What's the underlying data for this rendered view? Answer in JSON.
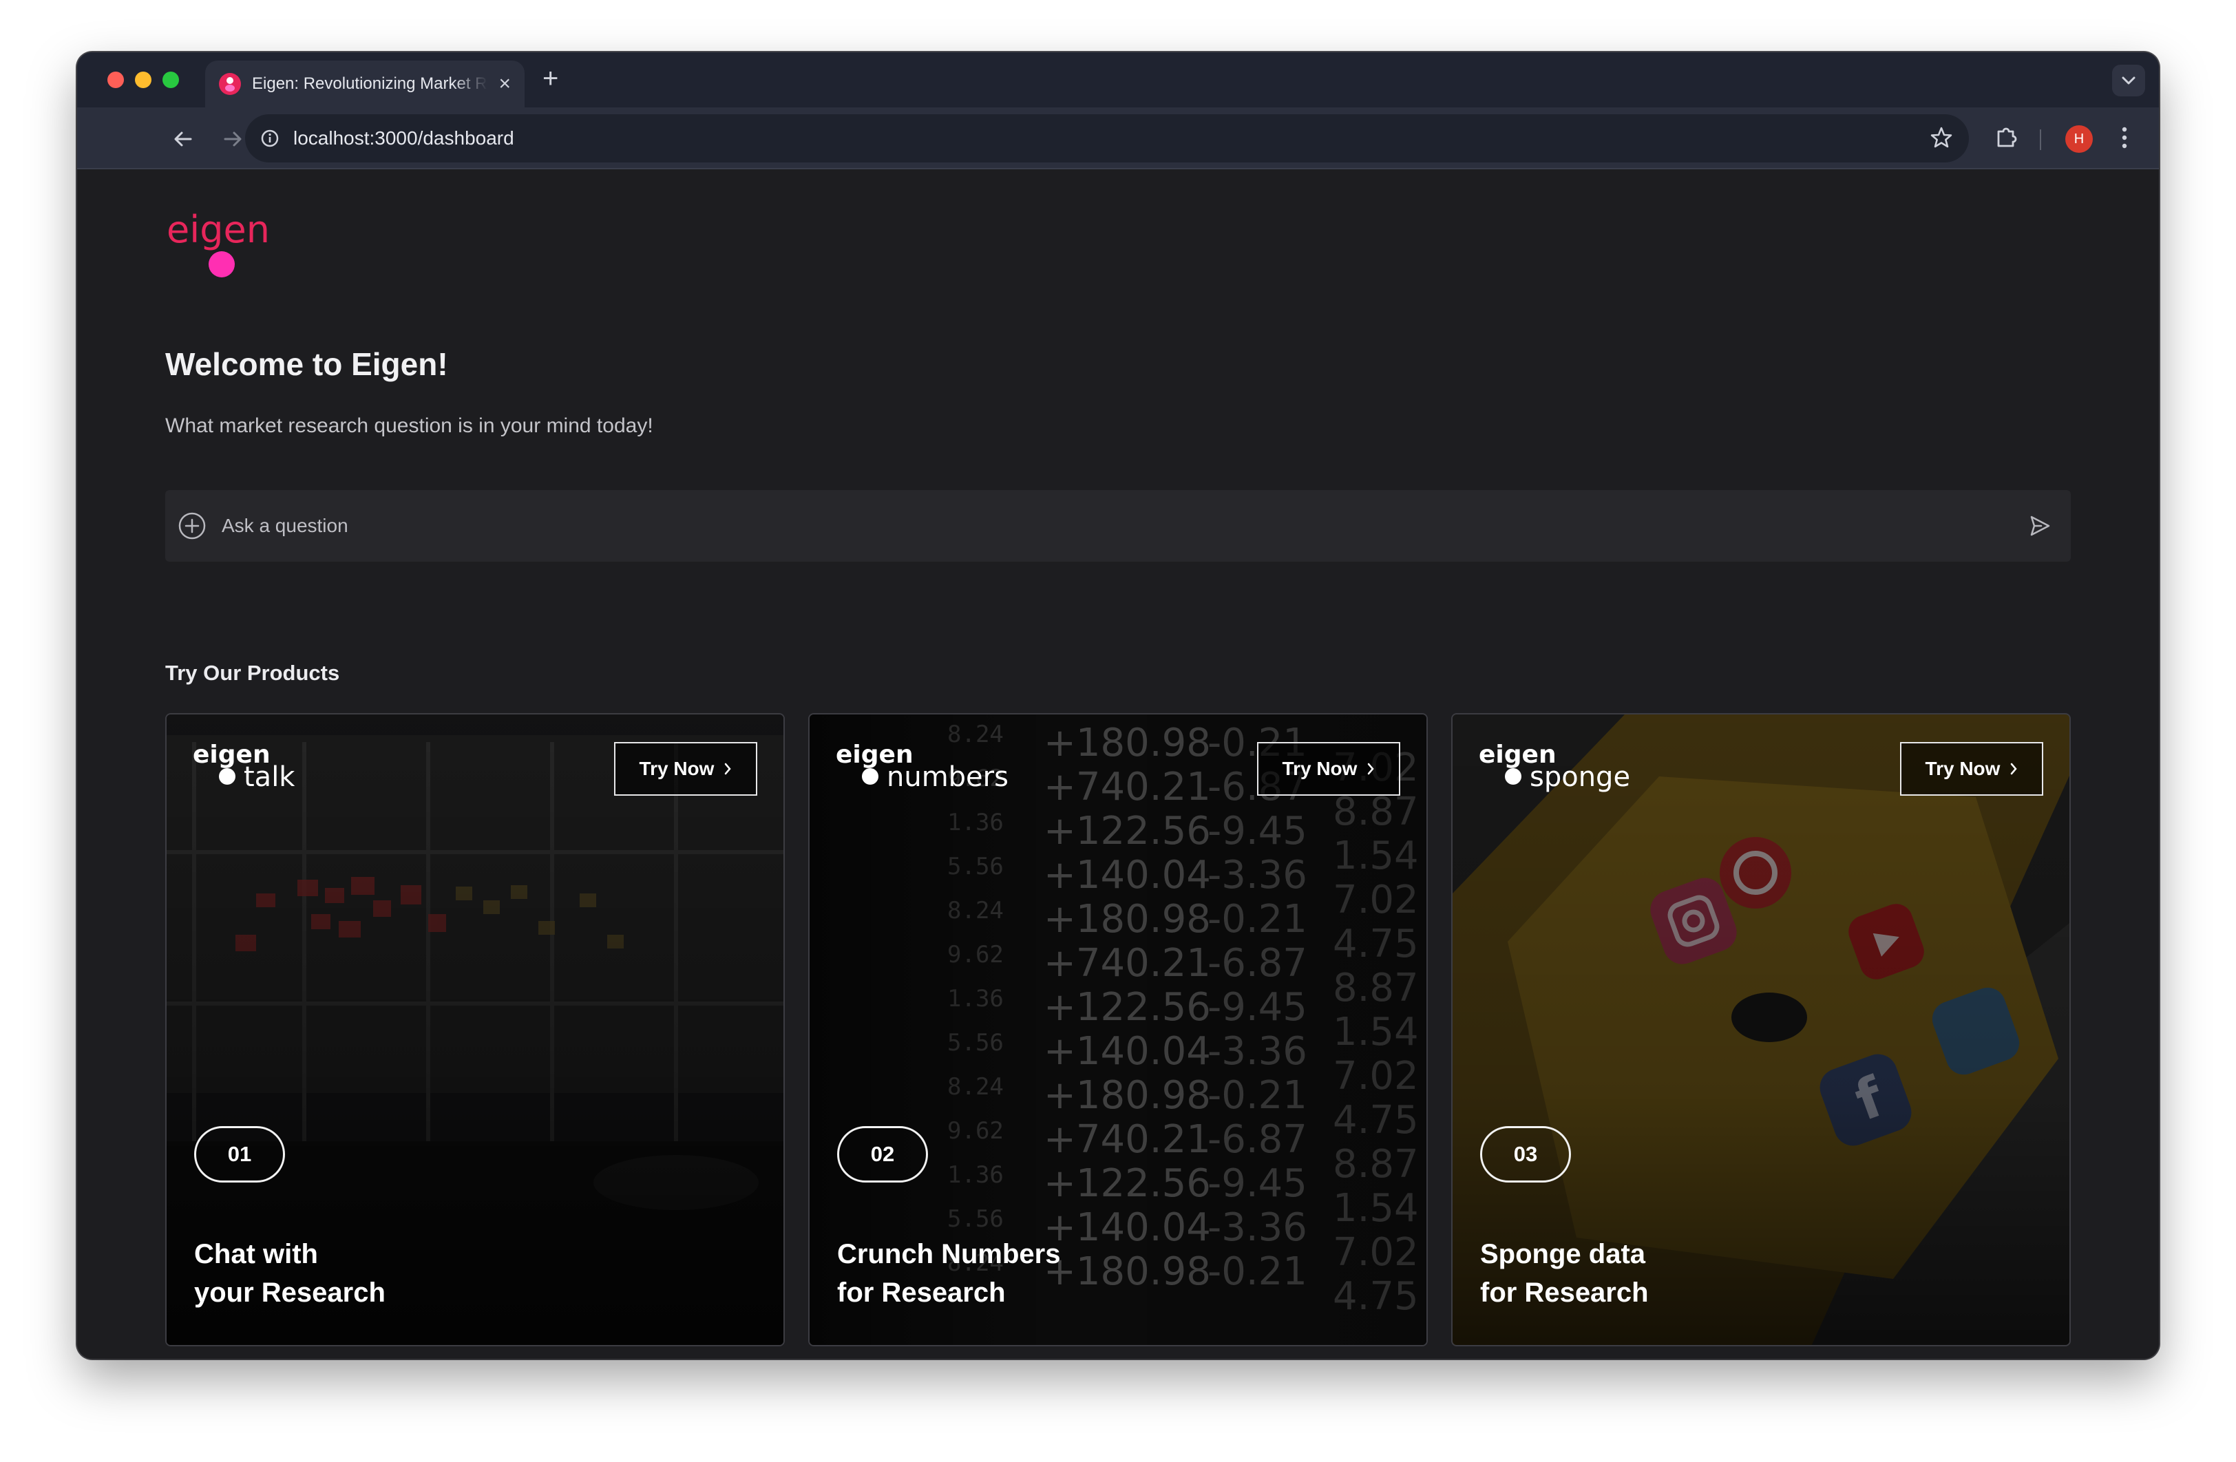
{
  "browser": {
    "tab_title": "Eigen: Revolutionizing Market Research",
    "url": "localhost:3000/dashboard",
    "avatar_initial": "H"
  },
  "colors": {
    "brand_red": "#e8265b",
    "brand_pink": "#ff2fb2",
    "page_bg": "#1d1d20",
    "ask_bg": "#27272b"
  },
  "brand": {
    "logo_text": "eigen"
  },
  "welcome": {
    "title": "Welcome to Eigen!",
    "subtitle": "What market research question is in your mind today!"
  },
  "ask": {
    "placeholder": "Ask a question",
    "add_icon": "plus-circle-icon",
    "send_icon": "send-icon"
  },
  "products": {
    "section_title": "Try Our Products",
    "items": [
      {
        "logo_brand": "eigen",
        "logo_product": "talk",
        "button": "Try Now",
        "number": "01",
        "line1": "Chat with",
        "line2": "your Research"
      },
      {
        "logo_brand": "eigen",
        "logo_product": "numbers",
        "button": "Try Now",
        "number": "02",
        "line1": "Crunch Numbers",
        "line2": "for Research"
      },
      {
        "logo_brand": "eigen",
        "logo_product": "sponge",
        "button": "Try Now",
        "number": "03",
        "line1": "Sponge data",
        "line2": "for Research"
      }
    ]
  },
  "stock_numbers": {
    "col1": [
      "+180.98",
      "+740.21",
      "+122.56",
      "+140.04",
      "+180.98",
      "+740.21",
      "+122.56",
      "+140.04",
      "+180.98",
      "+740.21",
      "+122.56",
      "+140.04",
      "+180.98"
    ],
    "col2": [
      "-0.21",
      "-6.87",
      "-9.45",
      "-3.36",
      "-0.21",
      "-6.87",
      "-9.45",
      "-3.36",
      "-0.21",
      "-6.87",
      "-9.45",
      "-3.36",
      "-0.21"
    ],
    "col3": [
      "7.02",
      "8.87",
      "1.54",
      "7.02",
      "4.75",
      "8.87",
      "1.54",
      "7.02",
      "4.75",
      "8.87",
      "1.54",
      "7.02",
      "4.75"
    ],
    "col0": [
      "8.24",
      "9.62",
      "1.36",
      "5.56",
      "8.24",
      "9.62",
      "1.36",
      "5.56",
      "8.24",
      "9.62",
      "1.36",
      "5.56",
      "8.24"
    ]
  }
}
